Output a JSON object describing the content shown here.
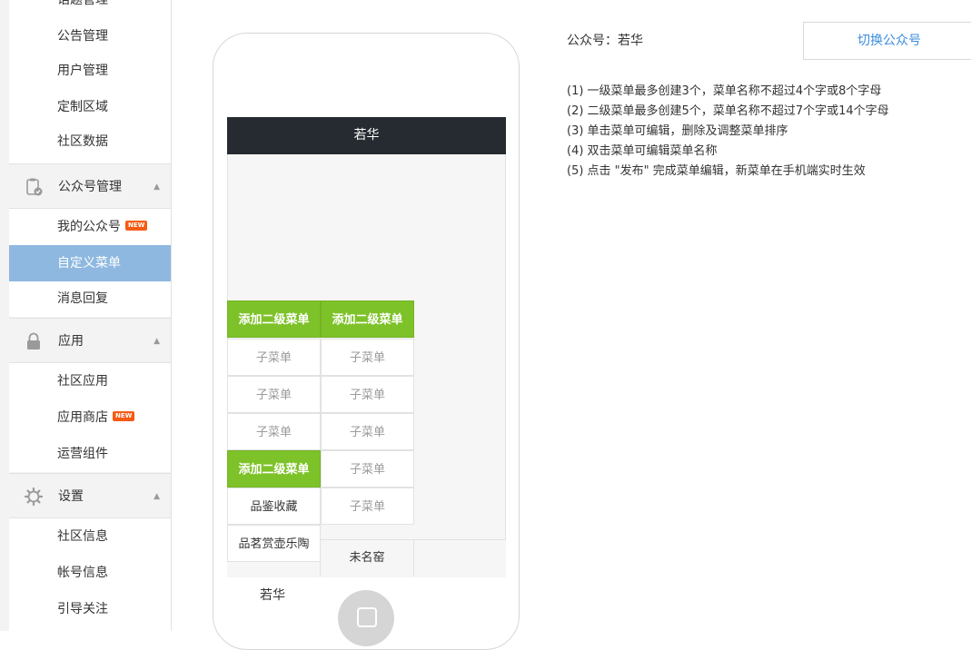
{
  "sidebar": {
    "top_items": [
      "话题管理",
      "公告管理",
      "用户管理",
      "定制区域",
      "社区数据"
    ],
    "sections": [
      {
        "label": "公众号管理",
        "icon": "clipboard-icon",
        "items": [
          {
            "label": "我的公众号",
            "badge": "NEW"
          },
          {
            "label": "自定义菜单",
            "active": true
          },
          {
            "label": "消息回复"
          }
        ]
      },
      {
        "label": "应用",
        "icon": "lock-icon",
        "items": [
          {
            "label": "社区应用"
          },
          {
            "label": "应用商店",
            "badge": "NEW"
          },
          {
            "label": "运营组件"
          }
        ]
      },
      {
        "label": "设置",
        "icon": "gear-icon",
        "items": [
          {
            "label": "社区信息"
          },
          {
            "label": "帐号信息"
          },
          {
            "label": "引导关注"
          }
        ]
      }
    ]
  },
  "phone": {
    "header_title": "若华",
    "col1": {
      "add_label": "添加二级菜单",
      "subs": [
        "子菜单",
        "子菜单",
        "子菜单"
      ]
    },
    "col2": {
      "add_label": "添加二级菜单",
      "subs": [
        "子菜单",
        "子菜单",
        "子菜单",
        "子菜单",
        "子菜单"
      ]
    },
    "col1b": {
      "add_label": "添加二级菜单",
      "items": [
        "品鉴收藏",
        "品茗赏壶乐陶"
      ]
    },
    "bottom_tabs": [
      "未名窑"
    ],
    "below_label": "若华"
  },
  "account": {
    "label": "公众号：若华",
    "switch_label": "切换公众号"
  },
  "tips": [
    "(1) 一级菜单最多创建3个，菜单名称不超过4个字或8个字母",
    "(2) 二级菜单最多创建5个，菜单名称不超过7个字或14个字母",
    "(3) 单击菜单可编辑，删除及调整菜单排序",
    "(4) 双击菜单可编辑菜单名称",
    "(5) 点击 \"发布\" 完成菜单编辑，新菜单在手机端实时生效"
  ]
}
